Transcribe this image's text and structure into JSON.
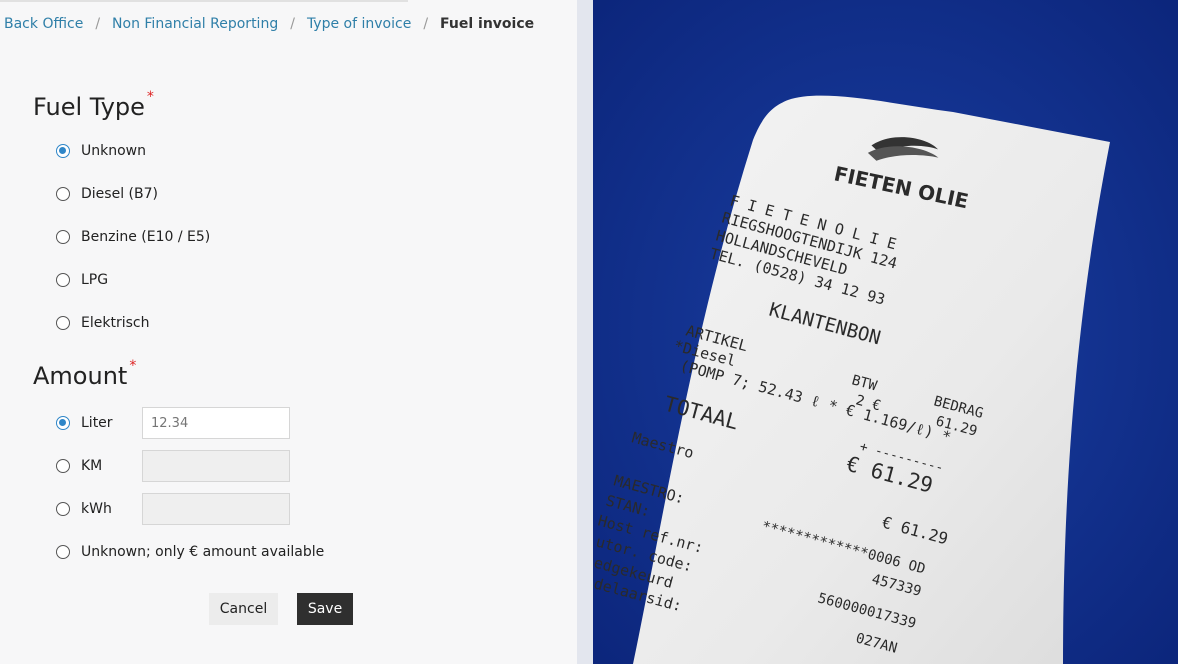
{
  "breadcrumb": {
    "items": [
      "Back Office",
      "Non Financial Reporting",
      "Type of invoice"
    ],
    "current": "Fuel invoice"
  },
  "fuel_type": {
    "title": "Fuel Type",
    "required_mark": "*",
    "options": [
      "Unknown",
      "Diesel (B7)",
      "Benzine (E10 / E5)",
      "LPG",
      "Elektrisch"
    ],
    "selected": "Unknown"
  },
  "amount": {
    "title": "Amount",
    "required_mark": "*",
    "options": [
      {
        "label": "Liter",
        "placeholder": "12.34"
      },
      {
        "label": "KM"
      },
      {
        "label": "kWh"
      },
      {
        "label": "Unknown; only € amount available"
      }
    ],
    "selected": "Liter"
  },
  "buttons": {
    "cancel": "Cancel",
    "save": "Save"
  },
  "colors": {
    "accent": "#2f86c8",
    "link": "#2f7fa8",
    "save_button": "#2f2f2f",
    "photo_background": "#0e2d8a"
  },
  "receipt": {
    "brand": "FIETEN OLIE",
    "lines": [
      "F I E T E N  O L I E",
      "RIEGSHOOGTENDIJK 124",
      "HOLLANDSCHEVELD",
      "TEL. (0528) 34 12 93",
      "KLANTENBON",
      "ARTIKEL",
      "*Diesel",
      "(POMP  7; 52.43 ℓ * € 1.169/ℓ) *",
      "BTW",
      "2  €",
      "BEDRAG",
      "61.29",
      "TOTAAL",
      "+ ---------",
      "Maestro",
      "€ 61.29",
      "MAESTRO:",
      "STAN:",
      "€ 61.29",
      "Host ref.nr:",
      "utor. code:",
      "edgekeurd",
      "delaarsid:",
      "*************0006 OD",
      "457339",
      "560000017339",
      "027AN"
    ]
  }
}
